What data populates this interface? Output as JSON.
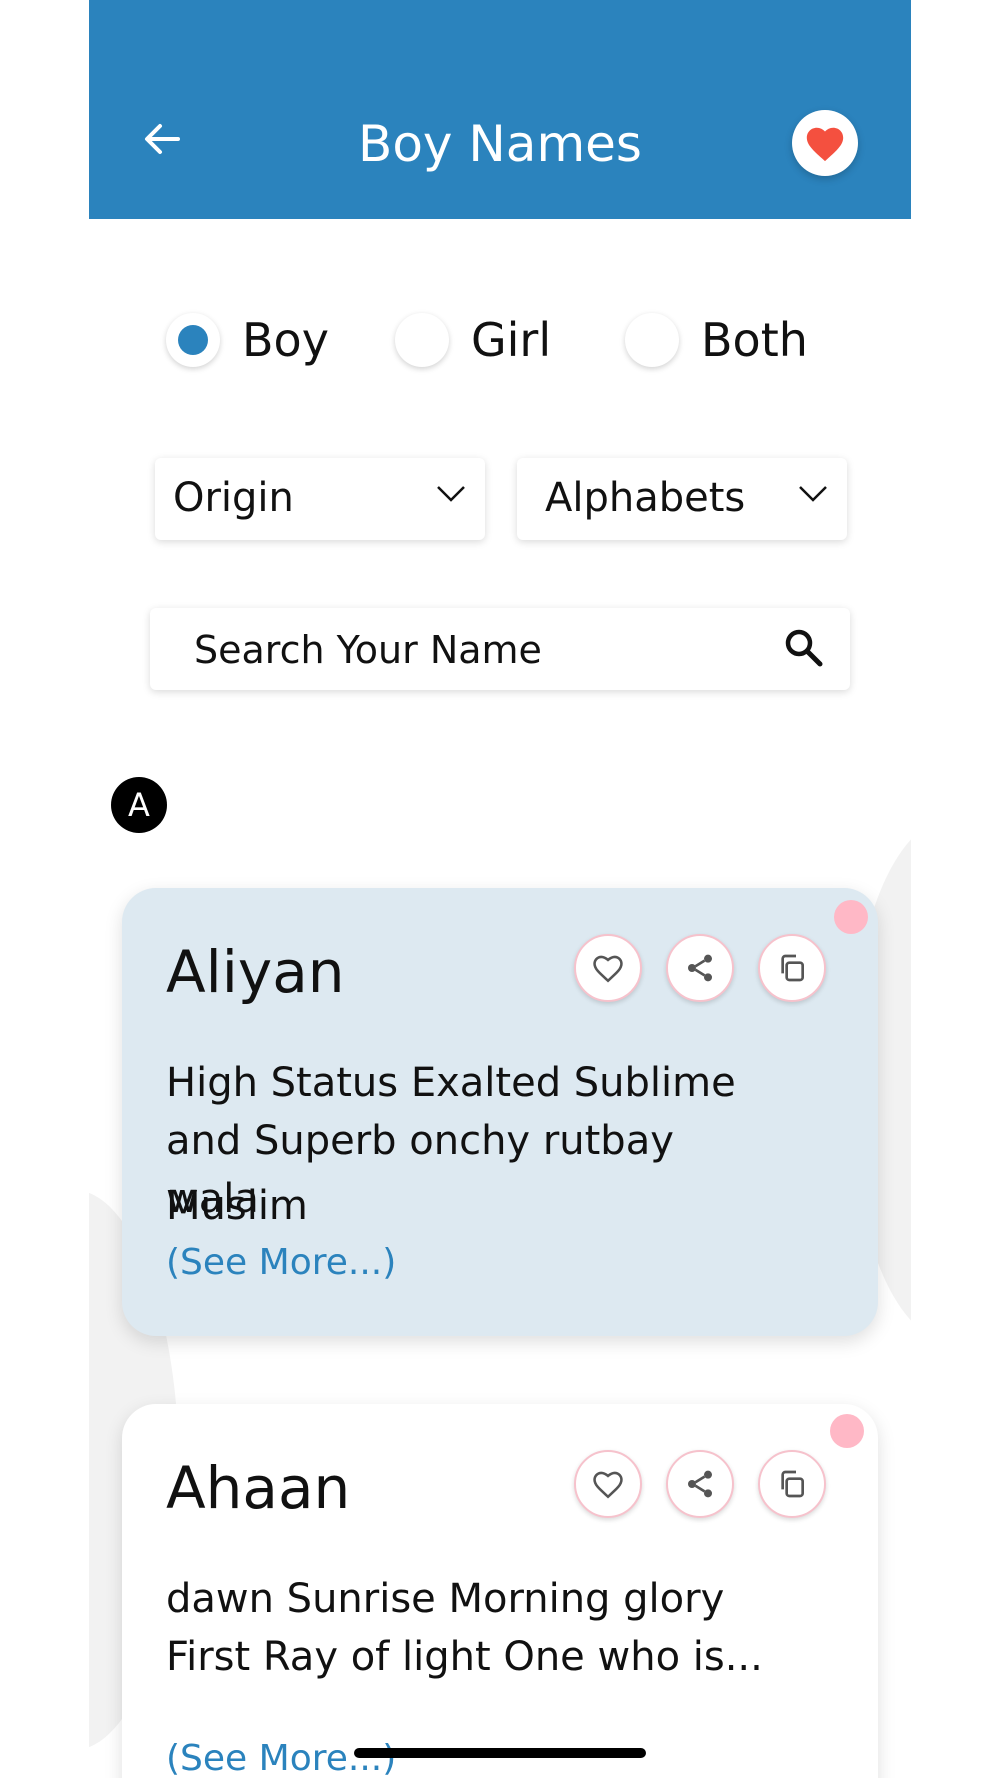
{
  "header": {
    "title": "Boy Names",
    "back_icon": "arrow-left-icon",
    "favorite_icon": "heart-icon"
  },
  "gender_filter": {
    "options": [
      {
        "label": "Boy",
        "selected": true
      },
      {
        "label": "Girl",
        "selected": false
      },
      {
        "label": "Both",
        "selected": false
      }
    ]
  },
  "filters": {
    "origin_label": "Origin",
    "alphabets_label": "Alphabets"
  },
  "search": {
    "placeholder": "Search Your Name"
  },
  "section_letter": "A",
  "names": [
    {
      "name": "Aliyan",
      "meaning": "High Status Exalted Sublime and Superb onchy rutbay wala",
      "origin": "Muslim",
      "see_more": "(See More...)"
    },
    {
      "name": "Ahaan",
      "meaning": "dawn Sunrise Morning glory First Ray of light One who is...",
      "see_more": "(See More...)"
    }
  ],
  "colors": {
    "primary": "#2b83bd",
    "card_highlight": "#dde9f1",
    "heart": "#f4503f",
    "pink_accent": "#ffb8c6"
  }
}
